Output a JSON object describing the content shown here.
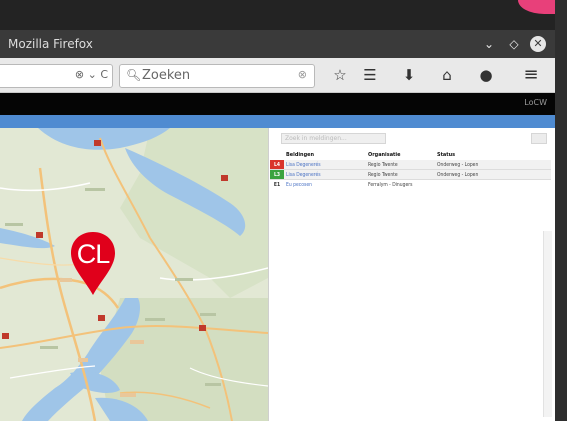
{
  "window": {
    "title": "Mozilla Firefox",
    "controls": {
      "minimize": "⌄",
      "maximize": "◇",
      "close": "✕"
    }
  },
  "navbar": {
    "url_icons": "⊗ ⌄ C",
    "search_placeholder": "Zoeken",
    "buttons": [
      {
        "name": "bookmark-star-icon",
        "glyph": "☆"
      },
      {
        "name": "reading-list-icon",
        "glyph": "☰"
      },
      {
        "name": "downloads-icon",
        "glyph": "⬇"
      },
      {
        "name": "home-icon",
        "glyph": "⌂"
      },
      {
        "name": "chat-icon",
        "glyph": "●"
      },
      {
        "name": "menu-icon",
        "glyph": "≡"
      }
    ]
  },
  "app": {
    "topbar_label": "LoCW",
    "accent_color": "#4f8bd1"
  },
  "map": {
    "marker": {
      "label": "CL",
      "color": "#e0001b"
    }
  },
  "panel": {
    "filter_placeholder": "Zoek in meldingen...",
    "columns": [
      "Beldingen",
      "Organisatie",
      "Status"
    ],
    "rows": [
      {
        "code": "L4",
        "code_color": "#d9342b",
        "melding": "Lisa Degenerés",
        "organisatie": "Regio Twente",
        "status": "Onderweg - Lopen"
      },
      {
        "code": "L3",
        "code_color": "#3aa33f",
        "melding": "Lisa Degenerés",
        "organisatie": "Regio Twente",
        "status": "Onderweg - Lopen"
      },
      {
        "code": "E1",
        "code_color": "#ffffff",
        "melding": "Eu pecosen",
        "organisatie": "Ferralym - Dinugers",
        "status": ""
      }
    ]
  }
}
